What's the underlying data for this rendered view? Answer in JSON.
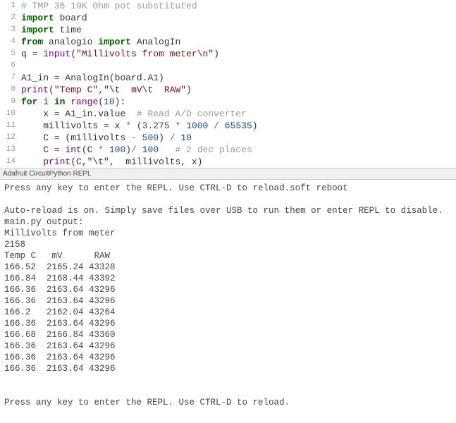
{
  "editor": {
    "lines": [
      {
        "num": "1",
        "tokens": [
          {
            "cls": "comment",
            "t": "# TMP 36 10K Ohm pot substituted"
          }
        ]
      },
      {
        "num": "2",
        "tokens": [
          {
            "cls": "kw",
            "t": "import"
          },
          {
            "cls": "plain",
            "t": " board"
          }
        ]
      },
      {
        "num": "3",
        "tokens": [
          {
            "cls": "kw",
            "t": "import"
          },
          {
            "cls": "plain",
            "t": " time"
          }
        ]
      },
      {
        "num": "4",
        "tokens": [
          {
            "cls": "kw",
            "t": "from"
          },
          {
            "cls": "plain",
            "t": " analogio "
          },
          {
            "cls": "kw",
            "t": "import"
          },
          {
            "cls": "plain",
            "t": " AnalogIn"
          }
        ]
      },
      {
        "num": "5",
        "tokens": [
          {
            "cls": "plain",
            "t": "q "
          },
          {
            "cls": "op",
            "t": "="
          },
          {
            "cls": "plain",
            "t": " "
          },
          {
            "cls": "builtin",
            "t": "input"
          },
          {
            "cls": "plain",
            "t": "("
          },
          {
            "cls": "str",
            "t": "\"Millivolts from meter\\n\""
          },
          {
            "cls": "plain",
            "t": ")"
          }
        ]
      },
      {
        "num": "6",
        "tokens": [
          {
            "cls": "plain",
            "t": ""
          }
        ]
      },
      {
        "num": "7",
        "tokens": [
          {
            "cls": "plain",
            "t": "A1_in "
          },
          {
            "cls": "op",
            "t": "="
          },
          {
            "cls": "plain",
            "t": " AnalogIn(board.A1)"
          }
        ]
      },
      {
        "num": "8",
        "tokens": [
          {
            "cls": "builtin",
            "t": "print"
          },
          {
            "cls": "plain",
            "t": "("
          },
          {
            "cls": "str",
            "t": "\"Temp C\""
          },
          {
            "cls": "plain",
            "t": ","
          },
          {
            "cls": "str",
            "t": "\"\\t  mV\\t  RAW\""
          },
          {
            "cls": "plain",
            "t": ")"
          }
        ]
      },
      {
        "num": "9",
        "tokens": [
          {
            "cls": "kw",
            "t": "for"
          },
          {
            "cls": "plain",
            "t": " i "
          },
          {
            "cls": "kw",
            "t": "in"
          },
          {
            "cls": "plain",
            "t": " "
          },
          {
            "cls": "builtin",
            "t": "range"
          },
          {
            "cls": "plain",
            "t": "("
          },
          {
            "cls": "num",
            "t": "10"
          },
          {
            "cls": "plain",
            "t": "):"
          }
        ]
      },
      {
        "num": "10",
        "tokens": [
          {
            "cls": "plain",
            "t": "    x "
          },
          {
            "cls": "op",
            "t": "="
          },
          {
            "cls": "plain",
            "t": " A1_in.value  "
          },
          {
            "cls": "comment",
            "t": "# Read A/D converter"
          }
        ]
      },
      {
        "num": "11",
        "tokens": [
          {
            "cls": "plain",
            "t": "    millivolts "
          },
          {
            "cls": "op",
            "t": "="
          },
          {
            "cls": "plain",
            "t": " x "
          },
          {
            "cls": "op",
            "t": "*"
          },
          {
            "cls": "plain",
            "t": " ("
          },
          {
            "cls": "num",
            "t": "3.275"
          },
          {
            "cls": "plain",
            "t": " "
          },
          {
            "cls": "op",
            "t": "*"
          },
          {
            "cls": "plain",
            "t": " "
          },
          {
            "cls": "num",
            "t": "1000"
          },
          {
            "cls": "plain",
            "t": " "
          },
          {
            "cls": "op",
            "t": "/"
          },
          {
            "cls": "plain",
            "t": " "
          },
          {
            "cls": "num",
            "t": "65535"
          },
          {
            "cls": "plain",
            "t": ")"
          }
        ]
      },
      {
        "num": "12",
        "tokens": [
          {
            "cls": "plain",
            "t": "    C "
          },
          {
            "cls": "op",
            "t": "="
          },
          {
            "cls": "plain",
            "t": " (millivolts "
          },
          {
            "cls": "op",
            "t": "-"
          },
          {
            "cls": "plain",
            "t": " "
          },
          {
            "cls": "num",
            "t": "500"
          },
          {
            "cls": "plain",
            "t": ") "
          },
          {
            "cls": "op",
            "t": "/"
          },
          {
            "cls": "plain",
            "t": " "
          },
          {
            "cls": "num",
            "t": "10"
          }
        ]
      },
      {
        "num": "13",
        "tokens": [
          {
            "cls": "plain",
            "t": "    C "
          },
          {
            "cls": "op",
            "t": "="
          },
          {
            "cls": "plain",
            "t": " "
          },
          {
            "cls": "builtin",
            "t": "int"
          },
          {
            "cls": "plain",
            "t": "(C "
          },
          {
            "cls": "op",
            "t": "*"
          },
          {
            "cls": "plain",
            "t": " "
          },
          {
            "cls": "num",
            "t": "100"
          },
          {
            "cls": "plain",
            "t": ")"
          },
          {
            "cls": "op",
            "t": "/"
          },
          {
            "cls": "plain",
            "t": " "
          },
          {
            "cls": "num",
            "t": "100"
          },
          {
            "cls": "plain",
            "t": "   "
          },
          {
            "cls": "comment",
            "t": "# 2 dec places"
          }
        ]
      },
      {
        "num": "14",
        "tokens": [
          {
            "cls": "plain",
            "t": "    "
          },
          {
            "cls": "builtin",
            "t": "print"
          },
          {
            "cls": "plain",
            "t": "(C,"
          },
          {
            "cls": "str",
            "t": "\"\\t\""
          },
          {
            "cls": "plain",
            "t": ",  millivolts, x)"
          }
        ]
      }
    ]
  },
  "repl": {
    "header": "Adafruit CircuitPython REPL",
    "text": "Press any key to enter the REPL. Use CTRL-D to reload.soft reboot\n\nAuto-reload is on. Simply save files over USB to run them or enter REPL to disable.\nmain.py output:\nMillivolts from meter\n2158\nTemp C   mV      RAW\n166.52  2165.24 43328\n166.84  2168.44 43392\n166.36  2163.64 43296\n166.36  2163.64 43296\n166.2   2162.04 43264\n166.36  2163.64 43296\n166.68  2166.84 43360\n166.36  2163.64 43296\n166.36  2163.64 43296\n166.36  2163.64 43296\n\n\nPress any key to enter the REPL. Use CTRL-D to reload."
  }
}
